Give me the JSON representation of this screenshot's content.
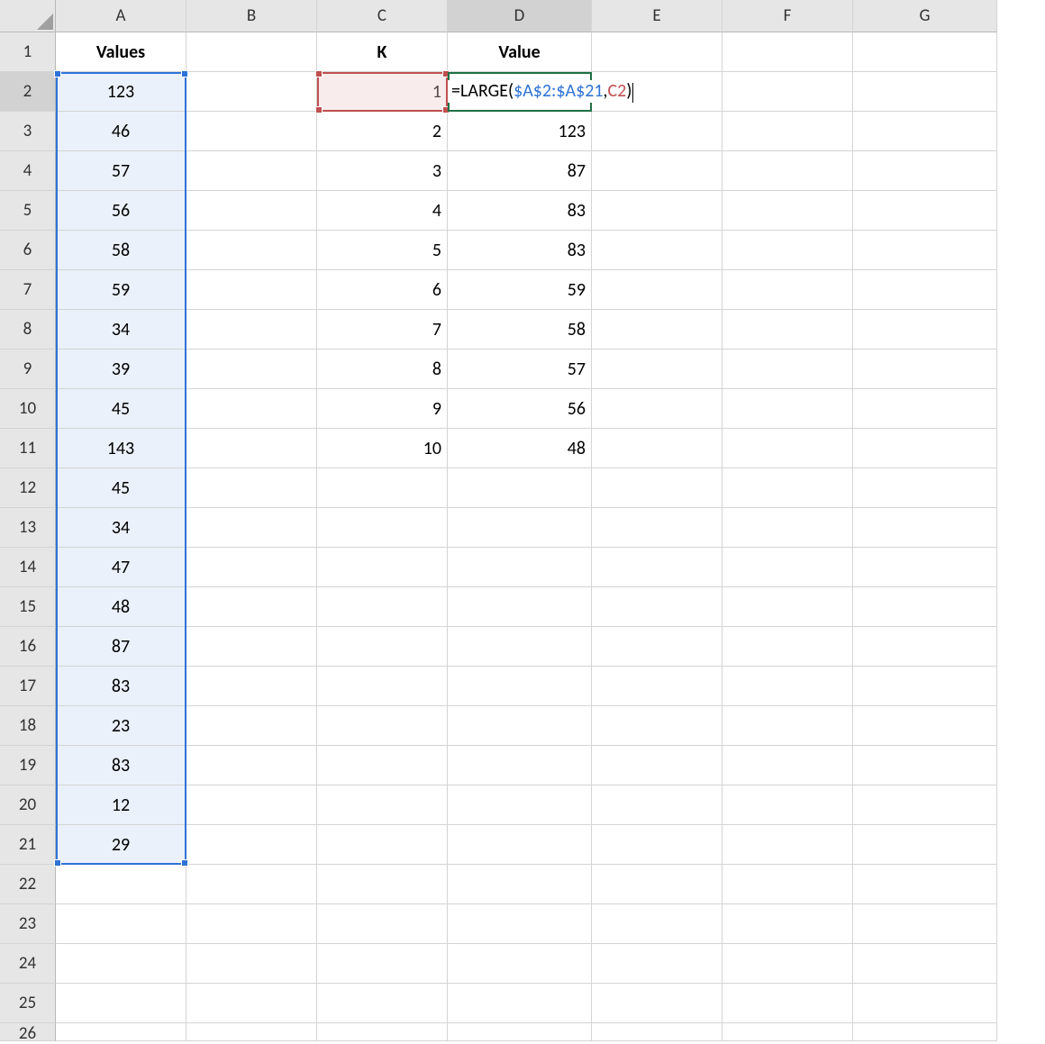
{
  "columns": [
    "A",
    "B",
    "C",
    "D",
    "E",
    "F",
    "G"
  ],
  "row_count": 25,
  "headers": {
    "A1": "Values",
    "C1": "K",
    "D1": "Value"
  },
  "colA_values": [
    "123",
    "46",
    "57",
    "56",
    "58",
    "59",
    "34",
    "39",
    "45",
    "143",
    "45",
    "34",
    "47",
    "48",
    "87",
    "83",
    "23",
    "83",
    "12",
    "29"
  ],
  "colC_values": [
    "1",
    "2",
    "3",
    "4",
    "5",
    "6",
    "7",
    "8",
    "9",
    "10"
  ],
  "colD_values": [
    "",
    "123",
    "87",
    "83",
    "83",
    "59",
    "58",
    "57",
    "56",
    "48"
  ],
  "formula": {
    "prefix": "=LARGE(",
    "range_ref": "$A$2:$A$21",
    "sep": ",",
    "k_ref": "C2",
    "suffix": ")"
  },
  "active_cell": "D2",
  "highlighted_range_blue": "A2:A21",
  "highlighted_range_red": "C2"
}
